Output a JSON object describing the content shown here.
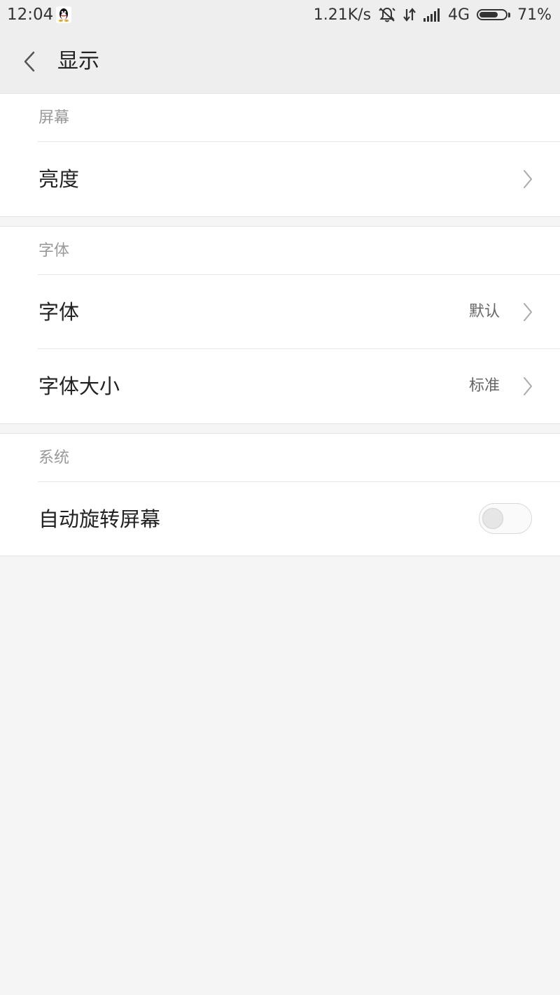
{
  "status_bar": {
    "time": "12:04",
    "network_speed": "1.21K/s",
    "network_type": "4G",
    "battery_percent": "71%",
    "battery_level": 0.71,
    "icons": [
      "qq-icon",
      "alarm-off-icon",
      "data-transfer-icon",
      "signal-icon",
      "battery-icon"
    ]
  },
  "header": {
    "title": "显示",
    "back_icon": "chevron-left-icon"
  },
  "sections": {
    "screen": {
      "header": "屏幕",
      "brightness": {
        "label": "亮度"
      }
    },
    "font": {
      "header": "字体",
      "font": {
        "label": "字体",
        "value": "默认"
      },
      "font_size": {
        "label": "字体大小",
        "value": "标准"
      }
    },
    "system": {
      "header": "系统",
      "auto_rotate": {
        "label": "自动旋转屏幕",
        "enabled": false
      }
    }
  },
  "colors": {
    "background": "#f5f5f5",
    "bar": "#eeeeee",
    "section_header_text": "#999999",
    "label_text": "#222222"
  }
}
